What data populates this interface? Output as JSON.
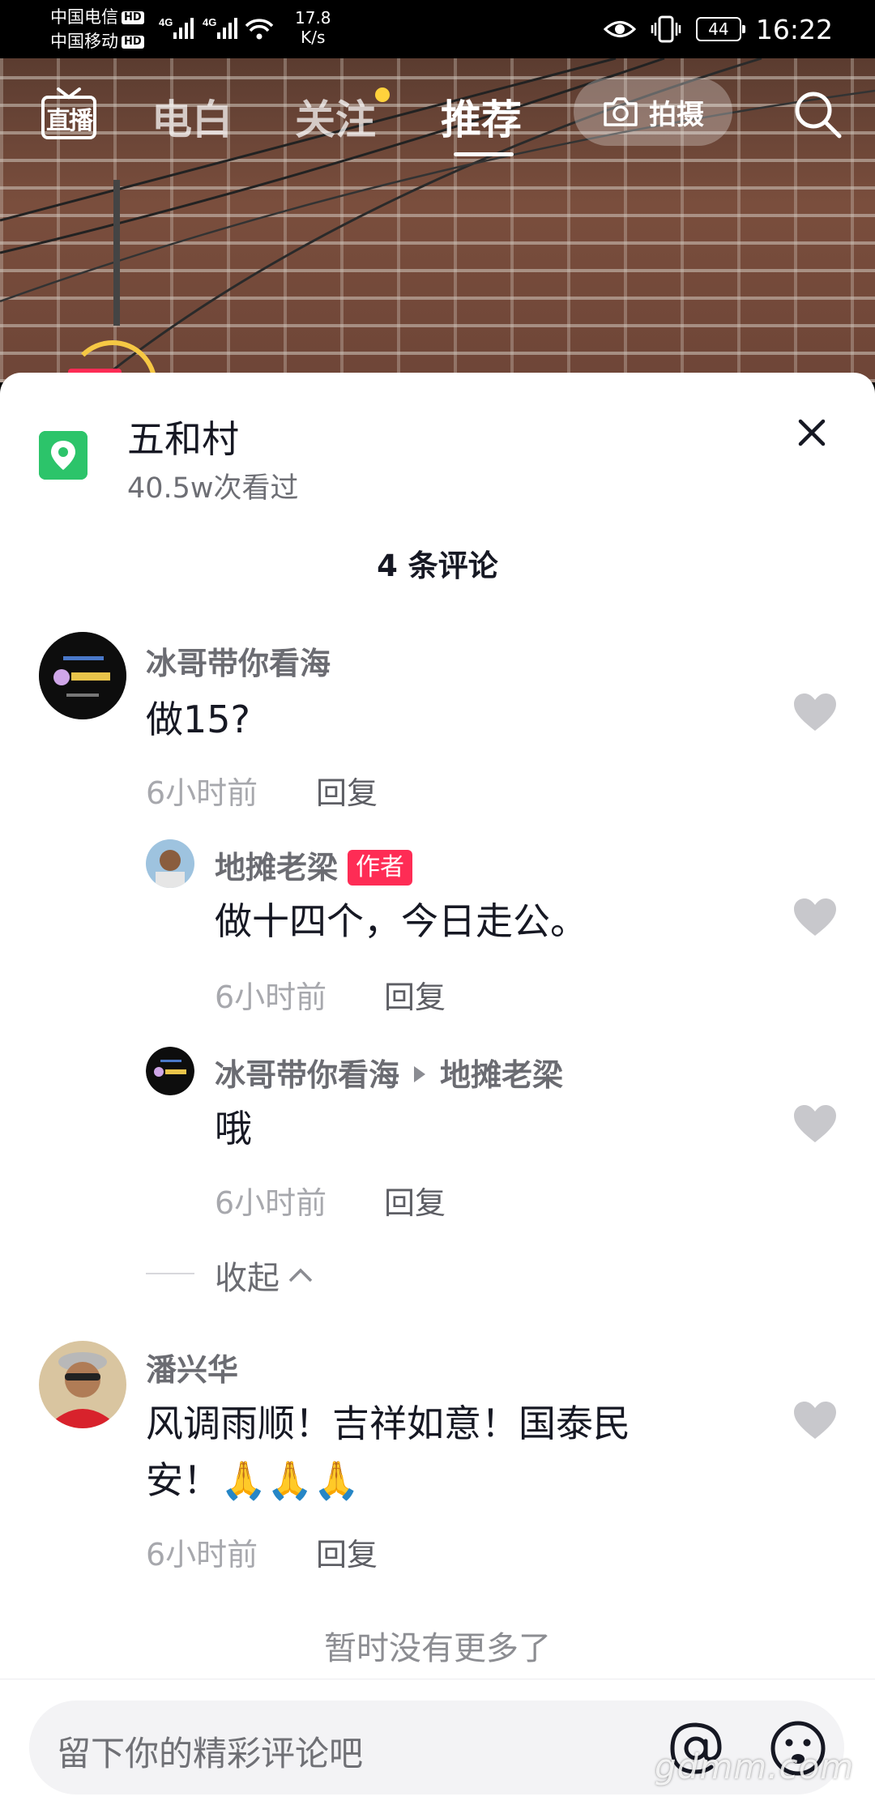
{
  "status_bar": {
    "carrier1": "中国电信",
    "carrier2": "中国移动",
    "hd": "HD",
    "network1": "4G",
    "network2": "4G",
    "speed_value": "17.8",
    "speed_unit": "K/s",
    "battery": "44",
    "time": "16:22"
  },
  "top_nav": {
    "live_label": "直播",
    "tabs": [
      "电白",
      "关注",
      "推荐"
    ],
    "active_tab": "推荐",
    "shoot_label": "拍摄"
  },
  "location": {
    "name": "五和村",
    "views": "40.5w次看过"
  },
  "comments_count": "4 条评论",
  "comments": [
    {
      "user": "冰哥带你看海",
      "text": "做15?",
      "time": "6小时前",
      "reply": "回复"
    },
    {
      "user": "地摊老梁",
      "badge": "作者",
      "text": "做十四个，今日走公。",
      "time": "6小时前",
      "reply": "回复"
    },
    {
      "user": "冰哥带你看海",
      "reply_to": "地摊老梁",
      "text": "哦",
      "time": "6小时前",
      "reply": "回复"
    },
    {
      "user": "潘兴华",
      "text_line1": "风调雨顺！吉祥如意！国泰民",
      "text_line2": "安！🙏🙏🙏",
      "time": "6小时前",
      "reply": "回复"
    }
  ],
  "collapse_label": "收起",
  "no_more": "暂时没有更多了",
  "input_placeholder": "留下你的精彩评论吧",
  "watermark": "gdmm.com",
  "colors": {
    "accent": "#fe2c55",
    "location": "#2cc46a",
    "dot": "#ffd23c"
  }
}
